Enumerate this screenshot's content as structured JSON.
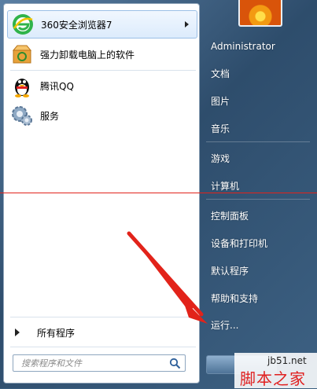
{
  "left_programs": [
    {
      "label": "360安全浏览器7",
      "icon": "browser-360-icon",
      "has_arrow": true
    },
    {
      "label": "强力卸载电脑上的软件",
      "icon": "uninstall-box-icon",
      "has_arrow": false
    },
    {
      "label": "腾讯QQ",
      "icon": "qq-penguin-icon",
      "has_arrow": false
    },
    {
      "label": "服务",
      "icon": "services-gear-icon",
      "has_arrow": false
    }
  ],
  "all_programs_label": "所有程序",
  "search": {
    "placeholder": "搜索程序和文件"
  },
  "right_items": [
    {
      "label": "Administrator"
    },
    {
      "label": "文档"
    },
    {
      "label": "图片"
    },
    {
      "label": "音乐"
    },
    {
      "label": "游戏"
    },
    {
      "label": "计算机"
    },
    {
      "label": "控制面板"
    },
    {
      "label": "设备和打印机"
    },
    {
      "label": "默认程序"
    },
    {
      "label": "帮助和支持"
    },
    {
      "label": "运行..."
    }
  ],
  "watermark": {
    "url": "jb51.net",
    "text": "脚本之家"
  },
  "colors": {
    "annotation_red": "#e2231a",
    "highlight": "#dcebfc"
  }
}
